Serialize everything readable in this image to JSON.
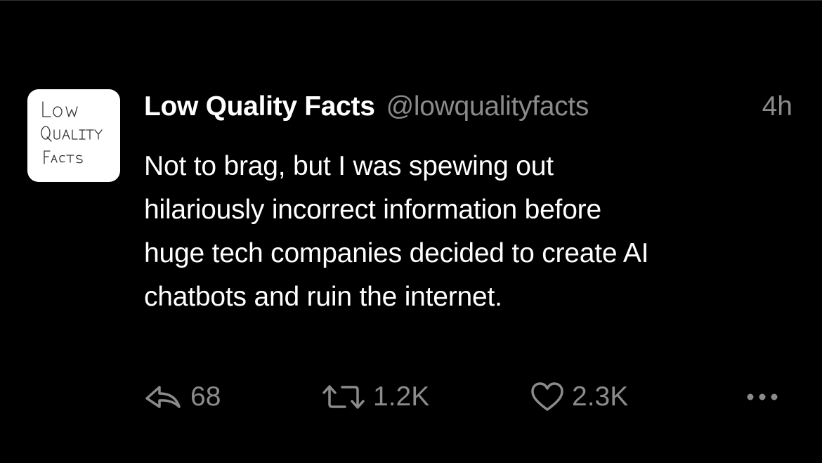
{
  "tweet": {
    "author": {
      "display_name": "Low Quality Facts",
      "handle": "@lowqualityfacts",
      "avatar_text": [
        "Low",
        "Quality",
        "Facts"
      ]
    },
    "timestamp": "4h",
    "text_lines": [
      "Not to brag, but I was spewing out",
      "hilariously incorrect information before",
      "huge tech companies decided to create AI",
      "chatbots and ruin the internet."
    ],
    "actions": {
      "reply": {
        "icon": "reply-icon",
        "count": "68"
      },
      "retweet": {
        "icon": "retweet-icon",
        "count": "1.2K"
      },
      "like": {
        "icon": "heart-icon",
        "count": "2.3K"
      },
      "more": {
        "icon": "more-dots-icon"
      }
    }
  },
  "colors": {
    "background": "#000000",
    "primary_text": "#ffffff",
    "secondary_text": "#8b8b8b",
    "avatar_bg": "#ffffff",
    "avatar_ink": "#333333"
  }
}
